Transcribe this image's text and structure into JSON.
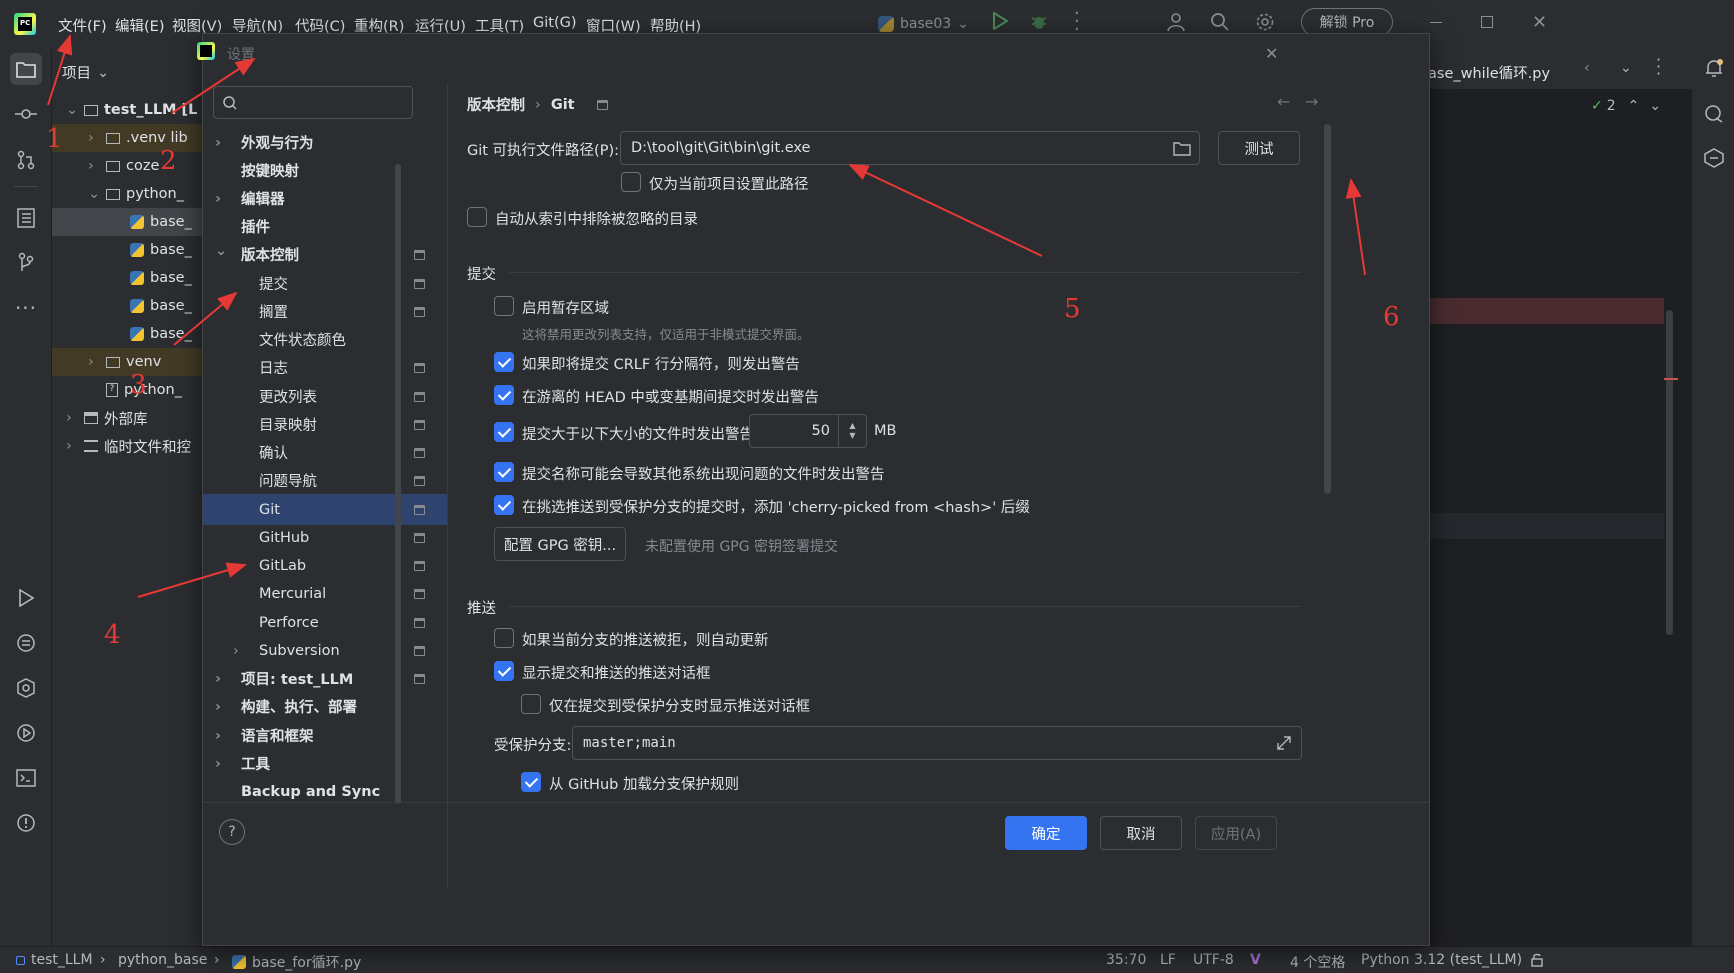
{
  "menubar": {
    "items": [
      "文件(F)",
      "编辑(E)",
      "视图(V)",
      "导航(N)",
      "代码(C)",
      "重构(R)",
      "运行(U)",
      "工具(T)",
      "Git(G)",
      "窗口(W)",
      "帮助(H)"
    ],
    "run_config": "base03",
    "unlock_pro": "解锁 Pro"
  },
  "project_panel": {
    "title": "项目",
    "rows": [
      {
        "label": "test_LLM [L",
        "icon": "folder-icon"
      },
      {
        "label": ".venv lib",
        "icon": "folder-icon"
      },
      {
        "label": "coze",
        "icon": "folder-icon"
      },
      {
        "label": "python_",
        "icon": "folder-icon"
      },
      {
        "label": "base_",
        "icon": "python-file-icon"
      },
      {
        "label": "base_",
        "icon": "python-file-icon"
      },
      {
        "label": "base_",
        "icon": "python-file-icon"
      },
      {
        "label": "base_",
        "icon": "python-file-icon"
      },
      {
        "label": "base_",
        "icon": "python-file-icon"
      },
      {
        "label": "venv",
        "icon": "folder-icon"
      },
      {
        "label": "python_",
        "icon": "unknown-file-icon"
      },
      {
        "label": "外部库",
        "icon": "library-icon"
      },
      {
        "label": "临时文件和控",
        "icon": "scratches-icon"
      }
    ]
  },
  "editor": {
    "tab_label": "ase_while循环.py",
    "inspection_count": "2"
  },
  "dialog": {
    "title": "设置",
    "search_placeholder": "",
    "nav": {
      "items": [
        {
          "label": "外观与行为"
        },
        {
          "label": "按键映射"
        },
        {
          "label": "编辑器"
        },
        {
          "label": "插件"
        },
        {
          "label": "版本控制"
        },
        {
          "label": "提交"
        },
        {
          "label": "搁置"
        },
        {
          "label": "文件状态颜色"
        },
        {
          "label": "日志"
        },
        {
          "label": "更改列表"
        },
        {
          "label": "目录映射"
        },
        {
          "label": "确认"
        },
        {
          "label": "问题导航"
        },
        {
          "label": "Git"
        },
        {
          "label": "GitHub"
        },
        {
          "label": "GitLab"
        },
        {
          "label": "Mercurial"
        },
        {
          "label": "Perforce"
        },
        {
          "label": "Subversion"
        },
        {
          "label": "项目: test_LLM"
        },
        {
          "label": "构建、执行、部署"
        },
        {
          "label": "语言和框架"
        },
        {
          "label": "工具"
        },
        {
          "label": "Backup and Sync"
        }
      ]
    },
    "breadcrumb": {
      "parent": "版本控制",
      "sep": "›",
      "current": "Git"
    },
    "git_path": {
      "label": "Git 可执行文件路径(P):",
      "value": "D:\\tool\\git\\Git\\bin\\git.exe",
      "test_button": "测试",
      "project_only": "仅为当前项目设置此路径"
    },
    "exclude_ignored": "自动从索引中排除被忽略的目录",
    "commit": {
      "section": "提交",
      "staging": "启用暂存区域",
      "staging_hint": "这将禁用更改列表支持，仅适用于非模式提交界面。",
      "crlf": "如果即将提交 CRLF 行分隔符，则发出警告",
      "detached": "在游离的 HEAD 中或变基期间提交时发出警告",
      "large_file": "提交大于以下大小的文件时发出警告:",
      "large_file_size": "50",
      "large_file_unit": "MB",
      "bad_names": "提交名称可能会导致其他系统出现问题的文件时发出警告",
      "cherry_pick": "在挑选推送到受保护分支的提交时，添加 'cherry-picked from <hash>' 后缀",
      "gpg_button": "配置 GPG 密钥...",
      "gpg_hint": "未配置使用 GPG 密钥签署提交"
    },
    "push": {
      "section": "推送",
      "auto_update": "如果当前分支的推送被拒，则自动更新",
      "show_dialog": "显示提交和推送的推送对话框",
      "protected_only": "仅在提交到受保护分支时显示推送对话框",
      "protected_label": "受保护分支:",
      "protected_value": "master;main",
      "github_rules": "从 GitHub 加载分支保护规则"
    },
    "footer": {
      "help": "?",
      "ok": "确定",
      "cancel": "取消",
      "apply": "应用(A)"
    }
  },
  "status": {
    "project": "test_LLM",
    "folder": "python_base",
    "file": "base_for循环.py",
    "position": "35:70",
    "line_sep": "LF",
    "encoding": "UTF-8",
    "indent": "4 个空格",
    "interpreter": "Python 3.12 (test_LLM)"
  },
  "annotations": [
    "1",
    "2",
    "3",
    "4",
    "5",
    "6"
  ],
  "colors": {
    "accent": "#3574f0",
    "annotation": "#e53935",
    "selection": "#2e436e"
  }
}
